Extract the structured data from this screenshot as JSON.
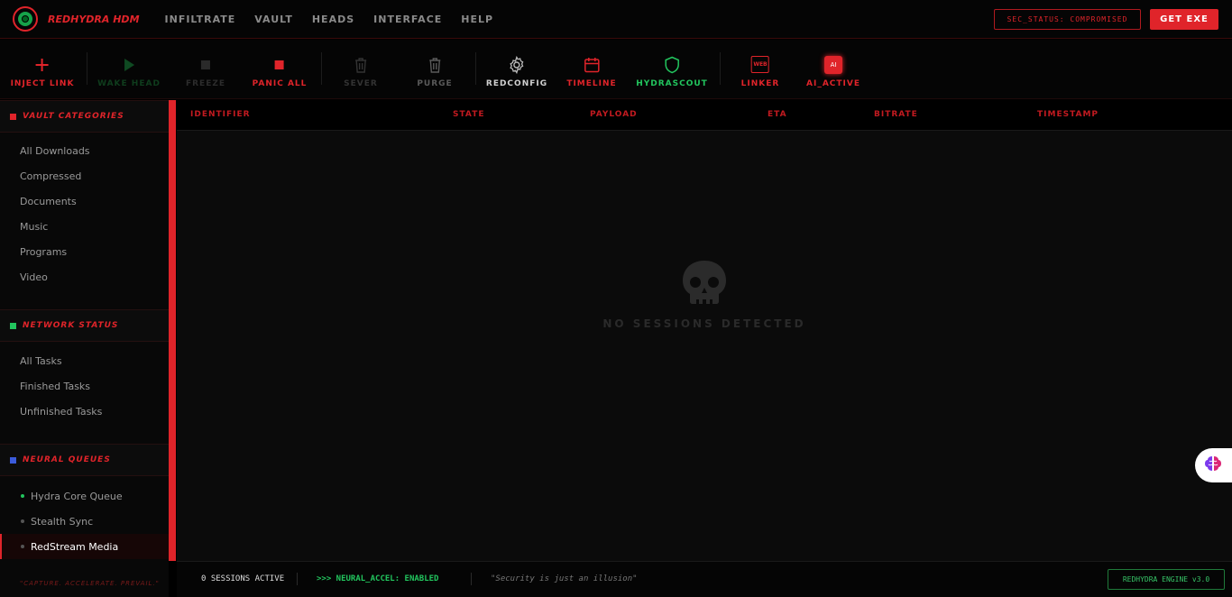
{
  "app": {
    "brand": "REDHYDRA HDM",
    "menu": [
      "INFILTRATE",
      "VAULT",
      "HEADS",
      "INTERFACE",
      "HELP"
    ],
    "sec_status": "SEC_STATUS: COMPROMISED",
    "get_exe": "GET EXE"
  },
  "toolbar": {
    "inject": "INJECT LINK",
    "wake": "WAKE HEAD",
    "freeze": "FREEZE",
    "panic": "PANIC ALL",
    "sever": "SEVER",
    "purge": "PURGE",
    "redconfig": "REDCONFIG",
    "timeline": "TIMELINE",
    "hydrascout": "HYDRASCOUT",
    "linker": "LINKER",
    "linker_badge": "WEB",
    "ai": "AI_ACTIVE",
    "ai_badge": "AI"
  },
  "sidebar": {
    "vault_title": "VAULT CATEGORIES",
    "vault_items": [
      "All Downloads",
      "Compressed",
      "Documents",
      "Music",
      "Programs",
      "Video"
    ],
    "network_title": "NETWORK STATUS",
    "network_items": [
      "All Tasks",
      "Finished Tasks",
      "Unfinished Tasks"
    ],
    "queues_title": "NEURAL QUEUES",
    "queues": [
      "Hydra Core Queue",
      "Stealth Sync",
      "RedStream Media"
    ],
    "motto": "\"CAPTURE. ACCELERATE. PREVAIL.\""
  },
  "table": {
    "columns": [
      "IDENTIFIER",
      "STATE",
      "PAYLOAD",
      "ETA",
      "BITRATE",
      "TIMESTAMP"
    ],
    "empty_text": "NO SESSIONS DETECTED"
  },
  "status": {
    "sessions": "0 SESSIONS ACTIVE",
    "neural": ">>> NEURAL_ACCEL: ENABLED",
    "quote": "\"Security is just an illusion\"",
    "engine": "REDHYDRA ENGINE v3.0"
  },
  "colors": {
    "accent": "#e0242a",
    "green": "#22c55e",
    "blue": "#3b5bdb"
  }
}
